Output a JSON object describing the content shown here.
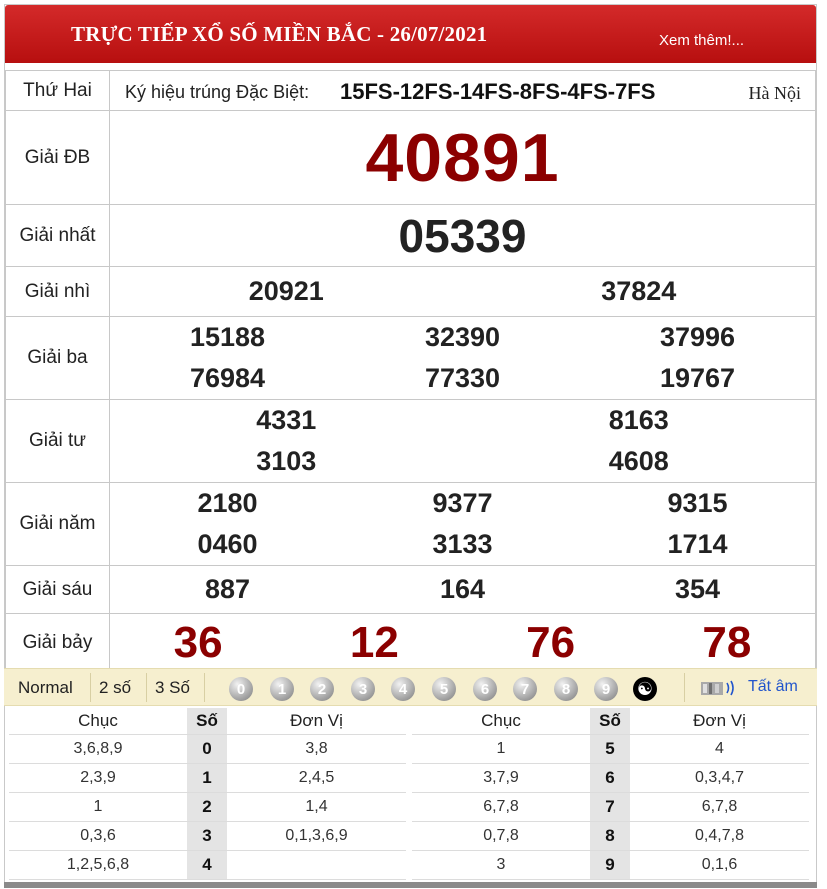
{
  "header": {
    "title": "TRỰC TIẾP XỔ SỐ MIỀN BẮC - 26/07/2021",
    "more_link": "Xem thêm!..."
  },
  "info": {
    "day": "Thứ Hai",
    "kyhieu_label": "Ký hiệu trúng Đặc Biệt:",
    "kyhieu_codes": "15FS-12FS-14FS-8FS-4FS-7FS",
    "location": "Hà Nội"
  },
  "prizes": {
    "db": {
      "label": "Giải ĐB",
      "numbers": [
        "40891"
      ]
    },
    "g1": {
      "label": "Giải nhất",
      "numbers": [
        "05339"
      ]
    },
    "g2": {
      "label": "Giải nhì",
      "numbers": [
        "20921",
        "37824"
      ]
    },
    "g3": {
      "label": "Giải ba",
      "numbers": [
        "15188",
        "32390",
        "37996",
        "76984",
        "77330",
        "19767"
      ]
    },
    "g4": {
      "label": "Giải tư",
      "numbers": [
        "4331",
        "8163",
        "3103",
        "4608"
      ]
    },
    "g5": {
      "label": "Giải năm",
      "numbers": [
        "2180",
        "9377",
        "9315",
        "0460",
        "3133",
        "1714"
      ]
    },
    "g6": {
      "label": "Giải sáu",
      "numbers": [
        "887",
        "164",
        "354"
      ]
    },
    "g7": {
      "label": "Giải bảy",
      "numbers": [
        "36",
        "12",
        "76",
        "78"
      ]
    }
  },
  "toolbar": {
    "modes": [
      "Normal",
      "2 số",
      "3 Số"
    ],
    "digits": [
      "0",
      "1",
      "2",
      "3",
      "4",
      "5",
      "6",
      "7",
      "8",
      "9"
    ],
    "yin_yang": "☯",
    "mute_label": "Tất âm"
  },
  "loto": {
    "headers": {
      "chuc": "Chục",
      "so": "Số",
      "donvi": "Đơn Vị"
    },
    "left": [
      {
        "chuc": "3,6,8,9",
        "so": "0",
        "donvi": "3,8"
      },
      {
        "chuc": "2,3,9",
        "so": "1",
        "donvi": "2,4,5"
      },
      {
        "chuc": "1",
        "so": "2",
        "donvi": "1,4"
      },
      {
        "chuc": "0,3,6",
        "so": "3",
        "donvi": "0,1,3,6,9"
      },
      {
        "chuc": "1,2,5,6,8",
        "so": "4",
        "donvi": ""
      }
    ],
    "right": [
      {
        "chuc": "1",
        "so": "5",
        "donvi": "4"
      },
      {
        "chuc": "3,7,9",
        "so": "6",
        "donvi": "0,3,4,7"
      },
      {
        "chuc": "6,7,8",
        "so": "7",
        "donvi": "6,7,8"
      },
      {
        "chuc": "0,7,8",
        "so": "8",
        "donvi": "0,4,7,8"
      },
      {
        "chuc": "3",
        "so": "9",
        "donvi": "0,1,6"
      }
    ]
  },
  "colors": {
    "header_red": "#c41a1a",
    "prize_red": "#8b0000",
    "toolbar_bg": "#f6efcf",
    "link_blue": "#2255cc"
  }
}
